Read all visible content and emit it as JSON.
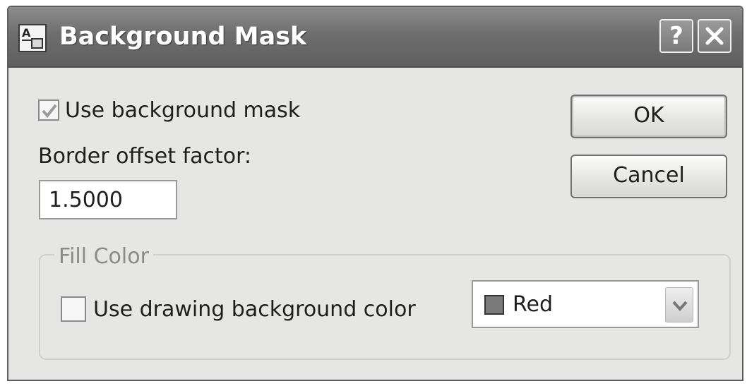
{
  "dialog": {
    "title": "Background Mask",
    "help_label": "?",
    "use_mask": {
      "label": "Use background mask",
      "checked": true
    },
    "offset": {
      "label": "Border offset factor:",
      "value": "1.5000"
    },
    "ok_label": "OK",
    "cancel_label": "Cancel",
    "fill": {
      "legend": "Fill Color",
      "use_drawing_bg": {
        "label": "Use drawing background color",
        "checked": false
      },
      "color": {
        "value": "Red",
        "swatch": "#7a7a7a"
      }
    }
  },
  "icons": [
    "autocad-text-icon",
    "help-icon",
    "close-icon",
    "checkmark-icon",
    "chevron-down-icon"
  ]
}
